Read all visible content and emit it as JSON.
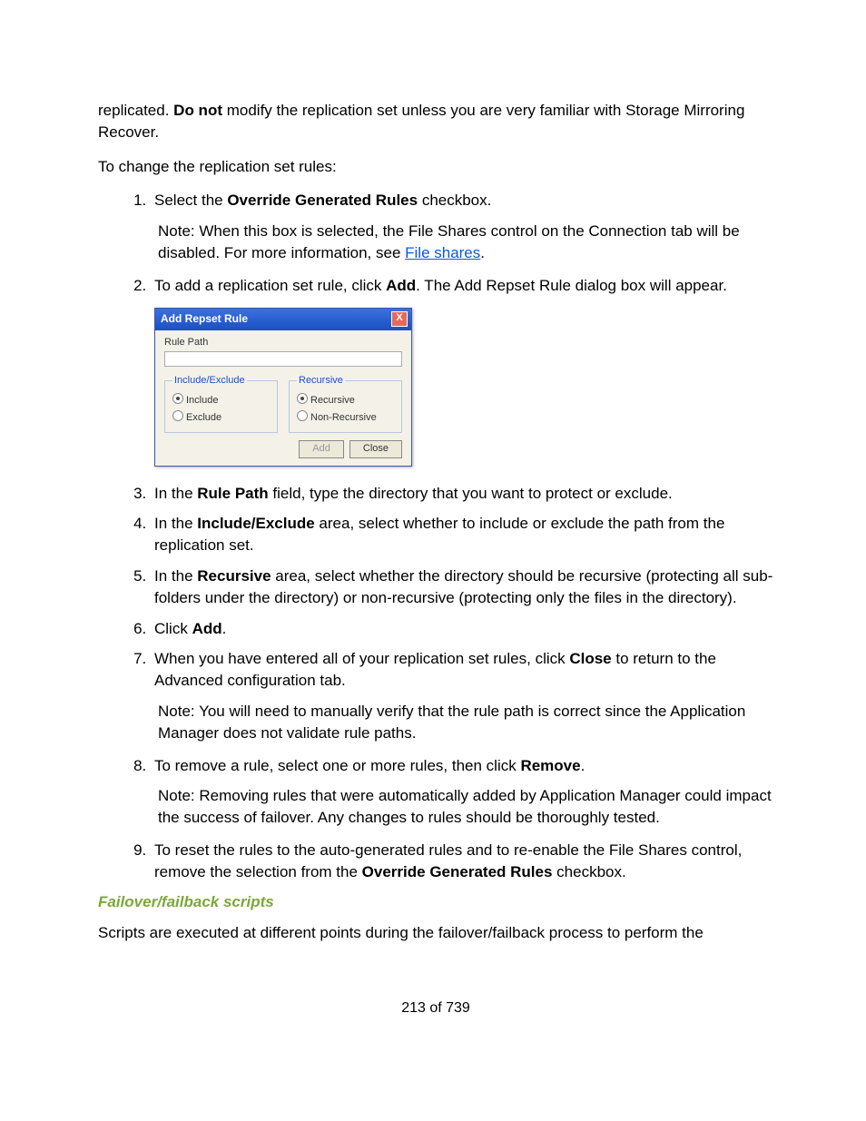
{
  "intro": {
    "p1a": "replicated. ",
    "p1b": "Do not",
    "p1c": " modify the replication set unless you are very familiar with Storage Mirroring Recover.",
    "p2": "To change the replication set rules:"
  },
  "steps": {
    "s1a": "Select the ",
    "s1b": "Override Generated Rules",
    "s1c": " checkbox.",
    "n1_label": "Note:",
    "n1a": "When this box is selected, the File Shares control on the Connection tab will be disabled. For more information, see ",
    "n1_link": "File shares",
    "n1b": ".",
    "s2a": "To add a replication set rule, click ",
    "s2b": "Add",
    "s2c": ". The Add Repset Rule dialog box will appear.",
    "s3a": "In the ",
    "s3b": "Rule Path",
    "s3c": " field, type the directory that you want to protect or exclude.",
    "s4a": "In the ",
    "s4b": "Include/Exclude",
    "s4c": " area, select whether to include or exclude the path from the replication set.",
    "s5a": "In the ",
    "s5b": "Recursive",
    "s5c": " area, select whether the directory should be recursive (protecting all sub-folders under the directory) or non-recursive (protecting only the files in the directory).",
    "s6a": "Click ",
    "s6b": "Add",
    "s6c": ".",
    "s7a": "When you have entered all of your replication set rules, click ",
    "s7b": "Close",
    "s7c": " to return to the Advanced configuration tab.",
    "n7_label": "Note:",
    "n7": "You will need to manually verify that the rule path is correct since the Application Manager does not validate rule paths.",
    "s8a": "To remove a rule, select one or more rules, then click ",
    "s8b": "Remove",
    "s8c": ".",
    "n8_label": "Note:",
    "n8": "Removing rules that were automatically added by Application Manager could impact the success of failover. Any changes to rules should be thoroughly tested.",
    "s9a": "To reset the rules to the auto-generated rules and to re-enable the File Shares control, remove the selection from the ",
    "s9b": "Override Generated Rules",
    "s9c": " checkbox."
  },
  "dialog": {
    "title": "Add Repset Rule",
    "close": "X",
    "rule_path_label": "Rule Path",
    "legend_incexc": "Include/Exclude",
    "opt_include": "Include",
    "opt_exclude": "Exclude",
    "legend_rec": "Recursive",
    "opt_recursive": "Recursive",
    "opt_nonrec": "Non-Recursive",
    "btn_add": "Add",
    "btn_close": "Close"
  },
  "section": {
    "heading": "Failover/failback scripts",
    "body": "Scripts are executed at different points during the failover/failback process to perform the"
  },
  "footer": "213 of 739"
}
